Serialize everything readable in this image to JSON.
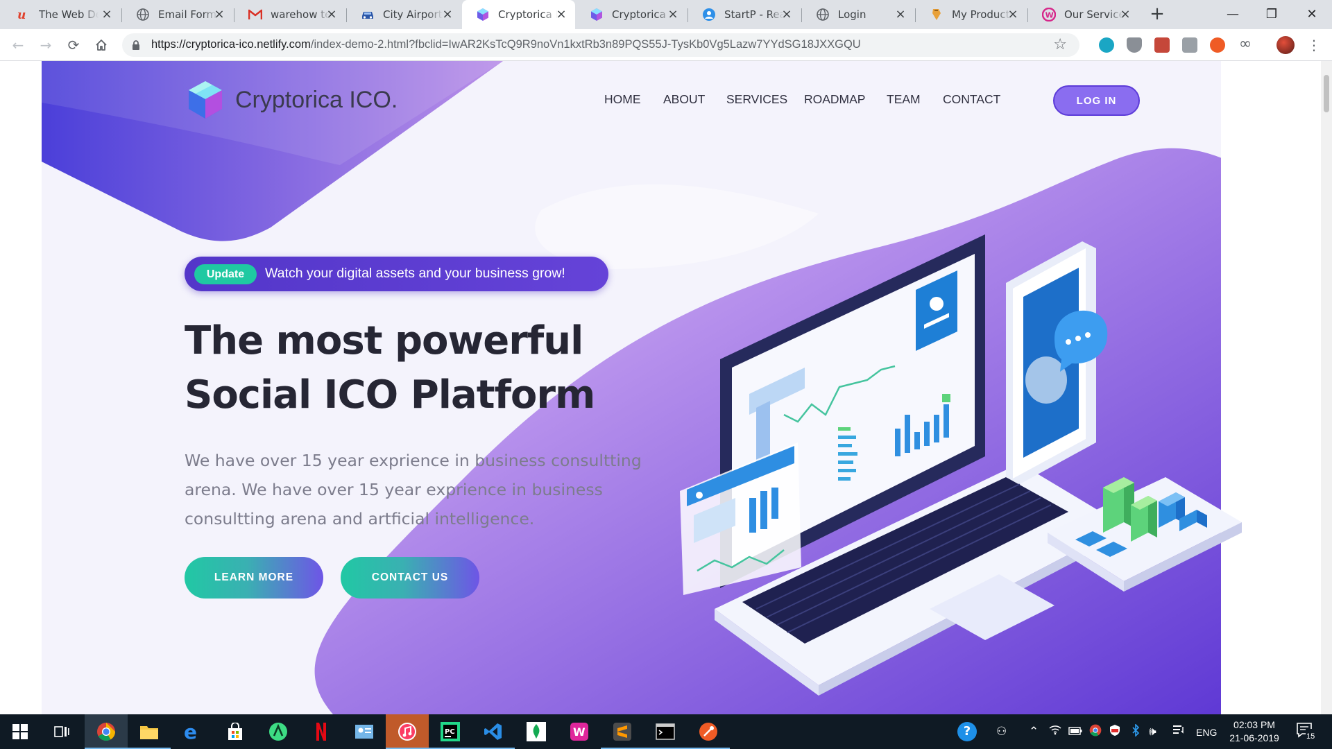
{
  "browser": {
    "tabs": [
      {
        "title": "The Web De",
        "icon": "wd-logo-icon",
        "active": false
      },
      {
        "title": "Email Form -",
        "icon": "globe-icon",
        "active": false
      },
      {
        "title": "warehow tec",
        "icon": "gmail-icon",
        "active": false
      },
      {
        "title": "City Airport",
        "icon": "car-icon",
        "active": false
      },
      {
        "title": "Cryptorica IC",
        "icon": "cube-icon",
        "active": true
      },
      {
        "title": "Cryptorica -",
        "icon": "cube-icon",
        "active": false
      },
      {
        "title": "StartP - Rea",
        "icon": "startp-icon",
        "active": false
      },
      {
        "title": "Login",
        "icon": "globe-icon",
        "active": false
      },
      {
        "title": "My Products",
        "icon": "product-icon",
        "active": false
      },
      {
        "title": "Our Services",
        "icon": "wp-icon",
        "active": false
      }
    ],
    "new_tab": "+",
    "window_controls": {
      "minimize": "—",
      "restore": "❐",
      "close": "✕"
    },
    "url_host": "https://cryptorica-ico.netlify.com",
    "url_path": "/index-demo-2.html?fbclid=IwAR2KsTcQ9R9noVn1kxtRb3n89PQS55J-TysKb0Vg5Lazw7YYdSG18JXXGQU"
  },
  "site": {
    "logo_text": "Cryptorica ICO.",
    "nav": [
      "HOME",
      "ABOUT",
      "SERVICES",
      "ROADMAP",
      "TEAM",
      "CONTACT"
    ],
    "login": "LOG IN",
    "badge_label": "Update",
    "badge_text": "Watch your digital assets and your business grow!",
    "headline_line1": "The most powerful",
    "headline_line2": "Social ICO Platform",
    "intro": "We have over 15 year exprience in business consultting arena. We have over 15 year exprience in business consultting arena and artficial intelligence.",
    "cta_primary": "LEARN MORE",
    "cta_secondary": "CONTACT US"
  },
  "colors": {
    "brand_purple": "#6a4be0",
    "accent_teal": "#1fc9a2",
    "heading": "#262634",
    "body_text": "#7c7c8c"
  },
  "taskbar": {
    "apps": [
      "chrome-icon",
      "file-explorer-icon",
      "edge-icon",
      "store-icon",
      "android-studio-icon",
      "netflix-icon",
      "contacts-icon",
      "itunes-icon",
      "pycharm-icon",
      "vscode-icon",
      "mongodb-icon",
      "wamp-icon",
      "sublime-icon",
      "terminal-icon",
      "postman-icon"
    ],
    "language": "ENG",
    "time": "02:03 PM",
    "date": "21-06-2019",
    "notifications": "15"
  }
}
